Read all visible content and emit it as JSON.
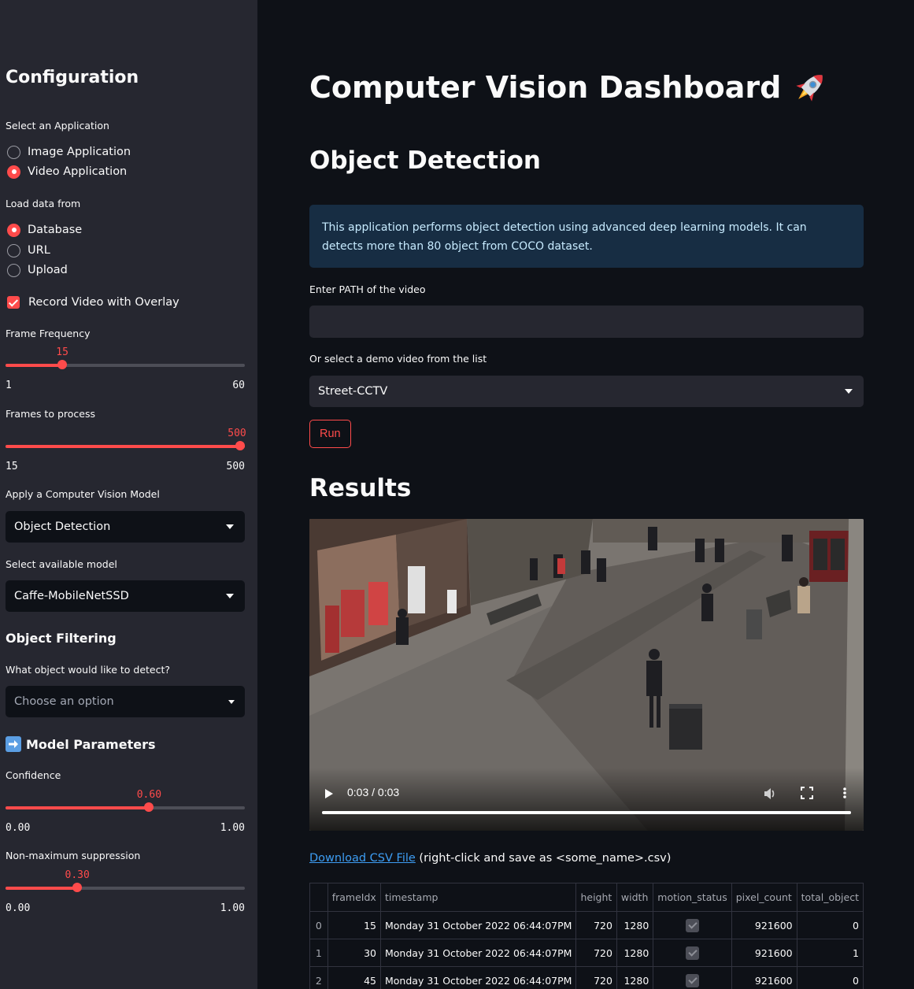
{
  "sidebar": {
    "title": "Configuration",
    "app_select": {
      "label": "Select an Application",
      "options": [
        "Image Application",
        "Video Application"
      ],
      "selected": "Video Application"
    },
    "data_source": {
      "label": "Load data from",
      "options": [
        "Database",
        "URL",
        "Upload"
      ],
      "selected": "Database"
    },
    "record_overlay": {
      "label": "Record Video with Overlay",
      "checked": true
    },
    "frame_frequency": {
      "label": "Frame Frequency",
      "value": 15,
      "min": 1,
      "max": 60,
      "value_text": "15",
      "min_text": "1",
      "max_text": "60"
    },
    "frames_to_process": {
      "label": "Frames to process",
      "value": 500,
      "min": 15,
      "max": 500,
      "value_text": "500",
      "min_text": "15",
      "max_text": "500"
    },
    "model_type": {
      "label": "Apply a Computer Vision Model",
      "value": "Object Detection"
    },
    "model": {
      "label": "Select available model",
      "value": "Caffe-MobileNetSSD"
    },
    "filtering": {
      "heading": "Object Filtering",
      "label": "What object would like to detect?",
      "placeholder": "Choose an option"
    },
    "params": {
      "heading": "Model Parameters",
      "icon": "right-arrow-emoji-icon",
      "confidence": {
        "label": "Confidence",
        "value": 0.6,
        "min": 0,
        "max": 1,
        "value_text": "0.60",
        "min_text": "0.00",
        "max_text": "1.00"
      },
      "nms": {
        "label": "Non-maximum suppression",
        "value": 0.3,
        "min": 0,
        "max": 1,
        "value_text": "0.30",
        "min_text": "0.00",
        "max_text": "1.00"
      }
    }
  },
  "main": {
    "title": "Computer Vision Dashboard",
    "title_icon": "rocket-icon",
    "section": "Object Detection",
    "info": "This application performs object detection using advanced deep learning models. It can detects more than 80 object from COCO dataset.",
    "path_input": {
      "label": "Enter PATH of the video",
      "value": ""
    },
    "demo_select": {
      "label": "Or select a demo video from the list",
      "value": "Street-CCTV"
    },
    "run_label": "Run",
    "results_heading": "Results",
    "video": {
      "time": "0:03 / 0:03",
      "progress": 1.0
    },
    "download": {
      "link": "Download CSV File",
      "suffix": "(right-click and save as <some_name>.csv)"
    },
    "table": {
      "columns": [
        "",
        "frameIdx",
        "timestamp",
        "height",
        "width",
        "motion_status",
        "pixel_count",
        "total_object"
      ],
      "rows": [
        {
          "idx": "0",
          "frameIdx": "15",
          "timestamp": "Monday 31 October 2022 06:44:07PM",
          "height": "720",
          "width": "1280",
          "motion_status": true,
          "pixel_count": "921600",
          "total_object": "0"
        },
        {
          "idx": "1",
          "frameIdx": "30",
          "timestamp": "Monday 31 October 2022 06:44:07PM",
          "height": "720",
          "width": "1280",
          "motion_status": true,
          "pixel_count": "921600",
          "total_object": "1"
        },
        {
          "idx": "2",
          "frameIdx": "45",
          "timestamp": "Monday 31 October 2022 06:44:07PM",
          "height": "720",
          "width": "1280",
          "motion_status": true,
          "pixel_count": "921600",
          "total_object": "0"
        }
      ]
    }
  }
}
